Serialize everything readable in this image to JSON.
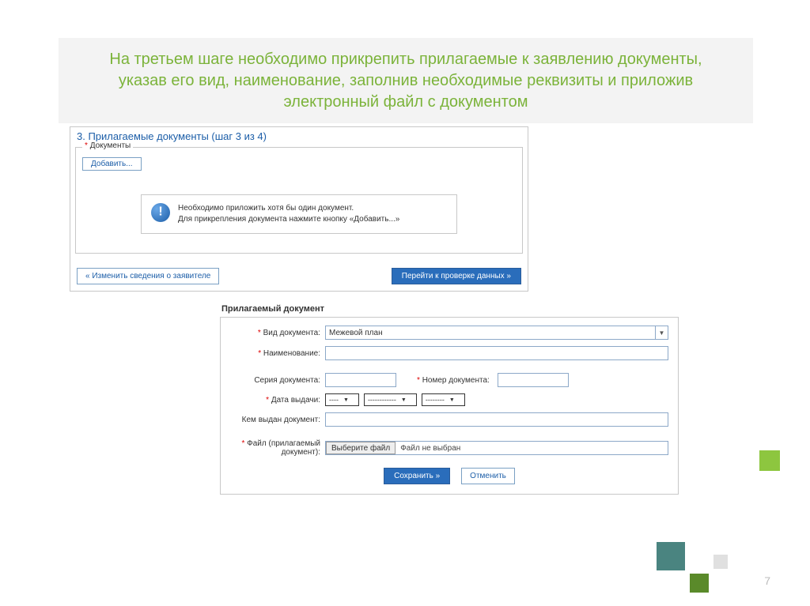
{
  "banner": {
    "text": "На третьем шаге необходимо прикрепить прилагаемые к заявлению документы, указав его вид, наименование, заполнив необходимые реквизиты и приложив электронный файл с документом"
  },
  "panel1": {
    "title": "3. Прилагаемые документы (шаг 3 из 4)",
    "docs_legend_req": "*",
    "docs_legend": "Документы",
    "add_button": "Добавить...",
    "info_line1": "Необходимо приложить хотя бы один документ.",
    "info_line2": "Для прикрепления документа нажмите кнопку «Добавить...»",
    "back_button": "« Изменить сведения о заявителе",
    "next_button": "Перейти к проверке данных »"
  },
  "panel2": {
    "title": "Прилагаемый документ",
    "labels": {
      "doc_type": "Вид документа:",
      "name": "Наименование:",
      "series": "Серия документа:",
      "number": "Номер документа:",
      "issue_date": "Дата выдачи:",
      "issued_by": "Кем выдан документ:",
      "file": "Файл (прилагаемый документ):"
    },
    "required_marks": {
      "doc_type": "*",
      "name": "*",
      "number": "*",
      "issue_date": "*",
      "file": "*"
    },
    "doc_type_value": "Межевой план",
    "date_parts": {
      "day": "----",
      "month": "------------",
      "year": "--------"
    },
    "file_button": "Выберите файл",
    "file_status": "Файл не выбран",
    "save_button": "Сохранить »",
    "cancel_button": "Отменить"
  },
  "page_number": "7"
}
